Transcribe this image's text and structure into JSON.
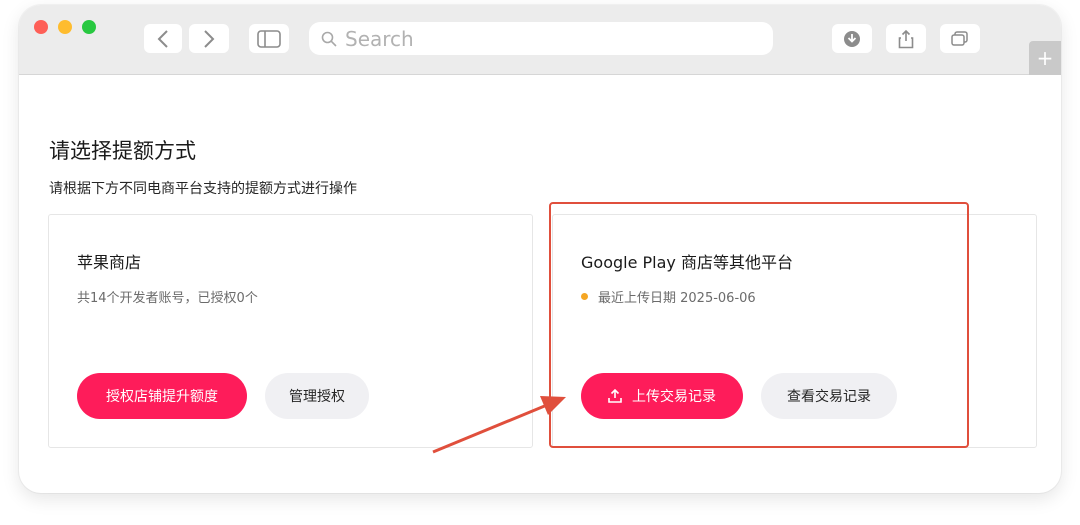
{
  "browser": {
    "search_placeholder": "Search"
  },
  "page": {
    "title": "请选择提额方式",
    "subtitle": "请根据下方不同电商平台支持的提额方式进行操作"
  },
  "cards": {
    "apple": {
      "title": "苹果商店",
      "description": "共14个开发者账号，已授权0个",
      "primary_button": "授权店铺提升额度",
      "secondary_button": "管理授权"
    },
    "google": {
      "title": "Google Play 商店等其他平台",
      "description": "最近上传日期 2025-06-06",
      "primary_button": "上传交易记录",
      "secondary_button": "查看交易记录"
    }
  },
  "colors": {
    "primary": "#fe1c5a",
    "secondary_bg": "#f0f0f3",
    "status_dot": "#f5a623",
    "annotation": "#e04f3c"
  },
  "icons": {
    "search": "search-icon",
    "upload": "upload-icon",
    "download": "download-icon",
    "share": "share-icon",
    "tabs": "tabs-icon"
  }
}
